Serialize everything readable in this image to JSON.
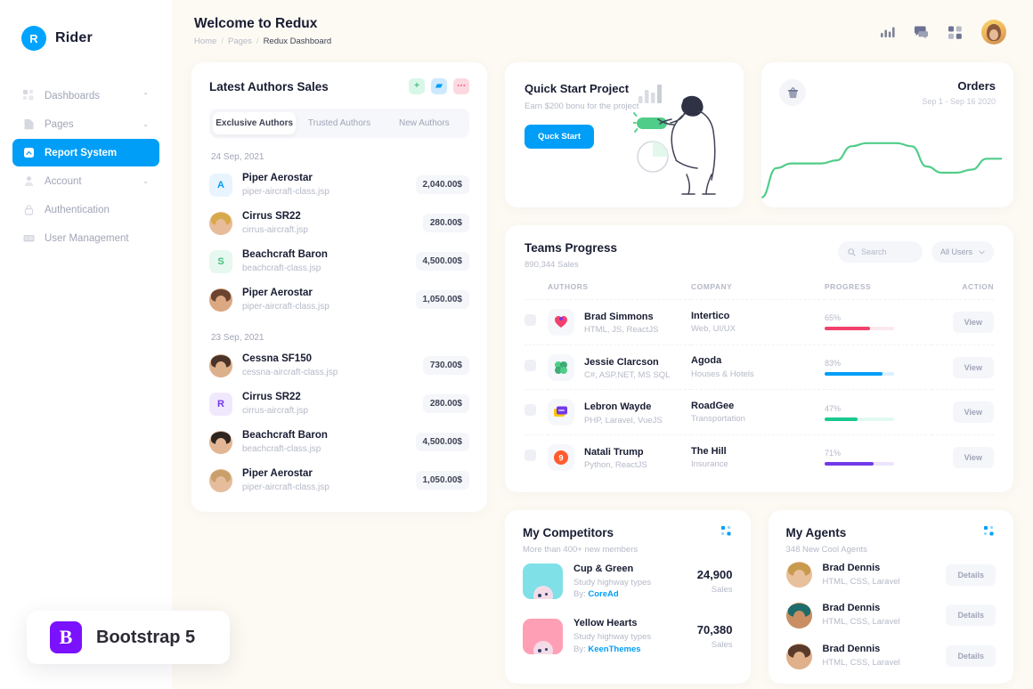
{
  "brand": {
    "initial": "R",
    "name": "Rider"
  },
  "sidebar": {
    "items": [
      {
        "label": "Dashboards",
        "icon": "grid-icon",
        "chevron": "⌃",
        "active": false
      },
      {
        "label": "Pages",
        "icon": "page-icon",
        "chevron": "⌄",
        "active": false
      },
      {
        "label": "Report System",
        "icon": "report-icon",
        "chevron": "",
        "active": true
      },
      {
        "label": "Account",
        "icon": "account-icon",
        "chevron": "⌄",
        "active": false
      },
      {
        "label": "Authentication",
        "icon": "lock-icon",
        "chevron": "",
        "active": false
      },
      {
        "label": "User Management",
        "icon": "users-icon",
        "chevron": "",
        "active": false
      }
    ]
  },
  "badge": {
    "mark": "B",
    "text": "Bootstrap 5",
    "color": "#7a12ff"
  },
  "header": {
    "title": "Welcome to Redux",
    "breadcrumb": [
      {
        "label": "Home",
        "current": false
      },
      {
        "label": "Pages",
        "current": false
      },
      {
        "label": "Redux Dashboard",
        "current": true
      }
    ],
    "separator": "/",
    "icons": [
      "chart-bar-icon",
      "chat-icon",
      "grid-apps-icon"
    ],
    "avatar": "user-avatar"
  },
  "authors_card": {
    "title": "Latest Authors Sales",
    "actions": [
      {
        "name": "add-icon",
        "glyph": "+",
        "bg": "#d9f7e8",
        "fg": "#47be7d"
      },
      {
        "name": "image-icon",
        "glyph": "▰",
        "bg": "#cdeafd",
        "fg": "#009ef7"
      },
      {
        "name": "more-icon",
        "glyph": "⋯",
        "bg": "#fcd9e0",
        "fg": "#f1416c"
      }
    ],
    "tabs": [
      {
        "label": "Exclusive Authors",
        "active": true
      },
      {
        "label": "Trusted Authors",
        "active": false
      },
      {
        "label": "New Authors",
        "active": false
      }
    ],
    "groups": [
      {
        "date": "24 Sep, 2021",
        "rows": [
          {
            "avatar_type": "initial",
            "initial": "A",
            "bg": "#e8f4fe",
            "fg": "#009ef7",
            "name": "Piper Aerostar",
            "file": "piper-aircraft-class.jsp",
            "amount": "2,040.00$"
          },
          {
            "avatar_type": "photo",
            "hair": "#d8a94a",
            "skin": "#e8bc9a",
            "name": "Cirrus SR22",
            "file": "cirrus-aircraft.jsp",
            "amount": "280.00$"
          },
          {
            "avatar_type": "initial",
            "initial": "S",
            "bg": "#e6f8ef",
            "fg": "#47be7d",
            "name": "Beachcraft Baron",
            "file": "beachcraft-class.jsp",
            "amount": "4,500.00$"
          },
          {
            "avatar_type": "photo",
            "hair": "#6b4330",
            "skin": "#dba882",
            "name": "Piper Aerostar",
            "file": "piper-aircraft-class.jsp",
            "amount": "1,050.00$"
          }
        ]
      },
      {
        "date": "23 Sep, 2021",
        "rows": [
          {
            "avatar_type": "photo",
            "hair": "#4a3428",
            "skin": "#ddb08c",
            "name": "Cessna SF150",
            "file": "cessna-aircraft-class.jsp",
            "amount": "730.00$"
          },
          {
            "avatar_type": "initial",
            "initial": "R",
            "bg": "#f0e9fd",
            "fg": "#7239ea",
            "name": "Cirrus SR22",
            "file": "cirrus-aircraft.jsp",
            "amount": "280.00$"
          },
          {
            "avatar_type": "photo",
            "hair": "#2e2420",
            "skin": "#e2b695",
            "name": "Beachcraft Baron",
            "file": "beachcraft-class.jsp",
            "amount": "4,500.00$"
          },
          {
            "avatar_type": "photo",
            "hair": "#c9a06a",
            "skin": "#e6bd9c",
            "name": "Piper Aerostar",
            "file": "piper-aircraft-class.jsp",
            "amount": "1,050.00$"
          }
        ]
      }
    ]
  },
  "quickstart": {
    "title": "Quick Start Project",
    "subtitle": "Earn $200 bonu for the project",
    "button": "Quck Start",
    "illustration": "person-with-charts-illustration"
  },
  "orders": {
    "title": "Orders",
    "date_range": "Sep 1 - Sep 16 2020",
    "icon": "basket-icon",
    "line_color": "#50cd89"
  },
  "chart_data": {
    "type": "line",
    "title": "Orders",
    "subtitle": "Sep 1 - Sep 16 2020",
    "xlabel": "",
    "ylabel": "",
    "grid": false,
    "legend": false,
    "series": [
      {
        "name": "Orders",
        "color": "#50cd89",
        "x": [
          1,
          2,
          3,
          4,
          5,
          6,
          7,
          8,
          9,
          10,
          11,
          12,
          13,
          14,
          15,
          16
        ],
        "values": [
          8,
          46,
          52,
          52,
          52,
          56,
          74,
          78,
          78,
          78,
          74,
          48,
          40,
          40,
          44,
          58,
          58
        ]
      }
    ],
    "ylim": [
      0,
      100
    ]
  },
  "teams": {
    "title": "Teams Progress",
    "subtitle": "890,344 Sales",
    "search_placeholder": "Search",
    "filter_value": "All Users",
    "columns": [
      "",
      "AUTHORS",
      "COMPANY",
      "PROGRESS",
      "ACTION"
    ],
    "action_label": "View",
    "rows": [
      {
        "logo": "intertico-logo",
        "logo_colors": [
          "#f1416c",
          "#7239ea"
        ],
        "name": "Brad Simmons",
        "skills": "HTML, JS, ReactJS",
        "company": "Intertico",
        "industry": "Web, UI/UX",
        "progress": "65%",
        "progress_value": 65,
        "bar_color": "#f1416c",
        "bar_bg": "#fde8ee"
      },
      {
        "logo": "agoda-logo",
        "logo_colors": [
          "#50cd89",
          "#2fa36a"
        ],
        "name": "Jessie Clarcson",
        "skills": "C#, ASP.NET, MS SQL",
        "company": "Agoda",
        "industry": "Houses & Hotels",
        "progress": "83%",
        "progress_value": 83,
        "bar_color": "#009ef7",
        "bar_bg": "#ddf1fe"
      },
      {
        "logo": "roadgee-logo",
        "logo_colors": [
          "#7239ea",
          "#ffc700"
        ],
        "name": "Lebron Wayde",
        "skills": "PHP, Laravel, VueJS",
        "company": "RoadGee",
        "industry": "Transportation",
        "progress": "47%",
        "progress_value": 47,
        "bar_color": "#17c88f",
        "bar_bg": "#e3faf1"
      },
      {
        "logo": "thehill-logo",
        "logo_colors": [
          "#ff5b2e",
          "#f1416c"
        ],
        "name": "Natali Trump",
        "skills": "Python, ReactJS",
        "company": "The Hill",
        "industry": "Insurance",
        "progress": "71%",
        "progress_value": 71,
        "bar_color": "#7239ea",
        "bar_bg": "#ece4fd"
      }
    ]
  },
  "competitors": {
    "title": "My Competitors",
    "subtitle": "More than 400+ new members",
    "menu_icon": "dots-grid-icon",
    "sales_label": "Sales",
    "by_label": "By:",
    "rows": [
      {
        "thumb_bg": "#7fe0e8",
        "name": "Cup & Green",
        "desc": "Study highway types",
        "by": "CoreAd",
        "value": "24,900"
      },
      {
        "thumb_bg": "#ff9fb6",
        "name": "Yellow Hearts",
        "desc": "Study highway types",
        "by": "KeenThemes",
        "value": "70,380"
      }
    ]
  },
  "agents": {
    "title": "My Agents",
    "subtitle": "348 New Cool Agents",
    "menu_icon": "dots-grid-icon",
    "details_label": "Details",
    "rows": [
      {
        "hair": "#c79a4e",
        "skin": "#e9c09c",
        "name": "Brad Dennis",
        "skills": "HTML, CSS, Laravel"
      },
      {
        "hair": "#1d6b6b",
        "skin": "#c98f62",
        "name": "Brad Dennis",
        "skills": "HTML, CSS, Laravel"
      },
      {
        "hair": "#5a3a2b",
        "skin": "#e0b08a",
        "name": "Brad Dennis",
        "skills": "HTML, CSS, Laravel"
      }
    ]
  }
}
